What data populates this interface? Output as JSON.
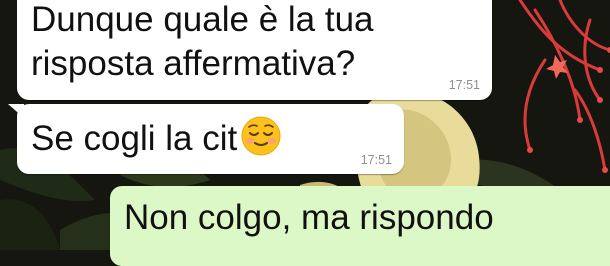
{
  "chat": {
    "messages": [
      {
        "direction": "incoming",
        "lines": [
          "Dunque quale è la tua",
          "risposta affermativa?"
        ],
        "time": "17:51"
      },
      {
        "direction": "incoming",
        "text": "Se cogli la cit",
        "emoji": "relieved-face-emoji",
        "time": "17:51"
      },
      {
        "direction": "outgoing",
        "text": "Non colgo, ma rispondo"
      }
    ]
  },
  "colors": {
    "incoming_bubble": "#ffffff",
    "outgoing_bubble": "#dcf8c6",
    "timestamp": "#8f8f8f",
    "wallpaper_dark": "#14160f",
    "wallpaper_petal": "#e9dc9a",
    "wallpaper_flower": "#d93b3b"
  }
}
